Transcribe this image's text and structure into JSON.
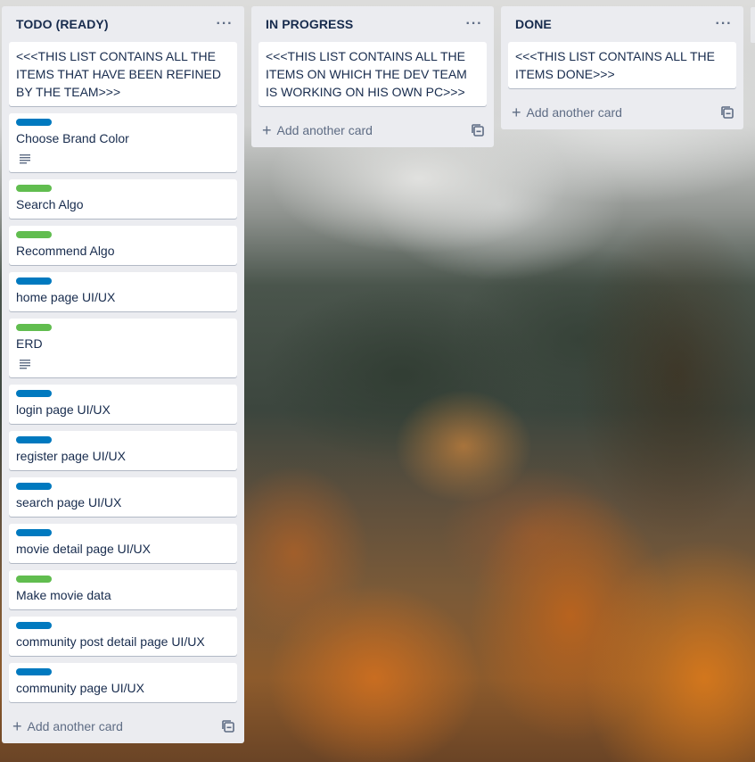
{
  "lists": [
    {
      "title": "TODO (READY)",
      "cards": [
        {
          "label_color": "",
          "title": "<<<THIS LIST CONTAINS ALL THE ITEMS THAT HAVE BEEN REFINED BY THE TEAM>>>",
          "has_description": false
        },
        {
          "label_color": "#0079bf",
          "title": "Choose Brand Color",
          "has_description": true
        },
        {
          "label_color": "#61bd4f",
          "title": "Search Algo",
          "has_description": false
        },
        {
          "label_color": "#61bd4f",
          "title": "Recommend Algo",
          "has_description": false
        },
        {
          "label_color": "#0079bf",
          "title": "home page UI/UX",
          "has_description": false
        },
        {
          "label_color": "#61bd4f",
          "title": "ERD",
          "has_description": true
        },
        {
          "label_color": "#0079bf",
          "title": "login page UI/UX",
          "has_description": false
        },
        {
          "label_color": "#0079bf",
          "title": "register page UI/UX",
          "has_description": false
        },
        {
          "label_color": "#0079bf",
          "title": "search page UI/UX",
          "has_description": false
        },
        {
          "label_color": "#0079bf",
          "title": "movie detail page UI/UX",
          "has_description": false
        },
        {
          "label_color": "#61bd4f",
          "title": "Make movie data",
          "has_description": false
        },
        {
          "label_color": "#0079bf",
          "title": "community post detail page UI/UX",
          "has_description": false
        },
        {
          "label_color": "#0079bf",
          "title": "community page UI/UX",
          "has_description": false
        }
      ],
      "add_card_label": "Add another card"
    },
    {
      "title": "IN PROGRESS",
      "cards": [
        {
          "label_color": "",
          "title": "<<<THIS LIST CONTAINS ALL THE ITEMS ON WHICH THE DEV TEAM IS WORKING ON HIS OWN PC>>>",
          "has_description": false
        }
      ],
      "add_card_label": "Add another card"
    },
    {
      "title": "DONE",
      "cards": [
        {
          "label_color": "",
          "title": "<<<THIS LIST CONTAINS ALL THE ITEMS DONE>>>",
          "has_description": false
        }
      ],
      "add_card_label": "Add another card"
    }
  ],
  "icons": {
    "list_menu": "more-horizontal-icon",
    "add": "plus-icon",
    "template": "card-template-icon",
    "description": "description-lines-icon"
  },
  "colors": {
    "list_bg": "#ebecf0",
    "label_blue": "#0079bf",
    "label_green": "#61bd4f",
    "text": "#172b4d",
    "subtle_text": "#5e6c84"
  }
}
